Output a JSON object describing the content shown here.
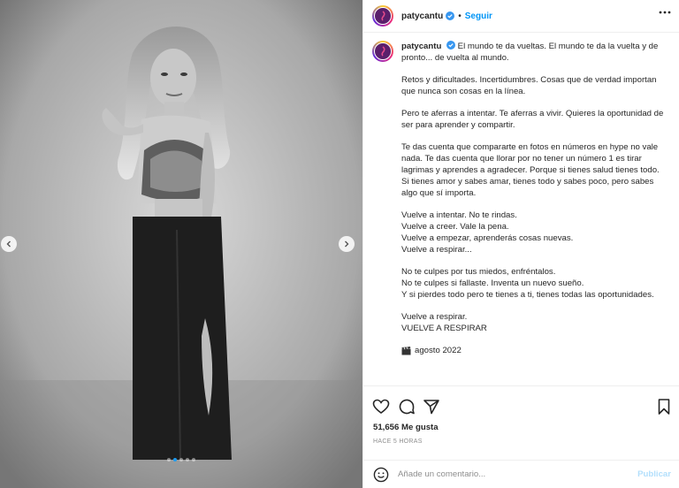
{
  "post": {
    "author": "patycantu",
    "follow_label": "Seguir",
    "separator": "•"
  },
  "caption": {
    "author": "patycantu",
    "head": "El mundo te da vueltas. El mundo te da la vuelta y de pronto... de vuelta al mundo.",
    "paragraphs": [
      "Retos y dificultades. Incertidumbres. Cosas que de verdad importan que nunca son cosas en la línea.",
      "Pero te aferras a intentar. Te aferras a vivir. Quieres la oportunidad de ser para aprender y compartir.",
      "Te das cuenta que compararte en fotos en números en hype no vale nada. Te das cuenta que llorar por no tener un número 1 es tirar lagrimas y aprendes a agradecer. Porque si tienes salud tienes todo. Si tienes amor y sabes amar, tienes todo y sabes poco, pero sabes algo que sí importa.",
      "Vuelve a intentar. No te rindas.\nVuelve a creer. Vale la pena.\nVuelve a empezar, aprenderás cosas nuevas.\nVuelve a respirar...",
      "No te culpes por tus miedos, enfréntalos.\nNo te culpes si fallaste. Inventa un nuevo sueño.\nY si pierdes todo pero te tienes a ti, tienes todas las oportunidades.",
      "Vuelve a respirar.\nVUELVE A RESPIRAR"
    ],
    "date_text": "agosto 2022"
  },
  "stats": {
    "likes": "51,656 Me gusta",
    "time_ago": "HACE 5 HORAS"
  },
  "comment_form": {
    "placeholder": "Añade un comentario...",
    "publish_label": "Publicar"
  },
  "carousel": {
    "total": 5,
    "active_index": 1
  },
  "icons": {
    "more": "more-dots-icon",
    "like": "heart-icon",
    "comment": "comment-bubble-icon",
    "share": "paper-plane-icon",
    "save": "bookmark-icon",
    "emoji": "smiley-icon",
    "verified": "verified-badge-icon",
    "prev": "chevron-left-icon",
    "next": "chevron-right-icon",
    "date": "clapperboard-icon"
  },
  "colors": {
    "accent": "#0095f6",
    "verified": "#3897f0",
    "muted": "#8e8e8e",
    "publish_disabled": "#b2dffc",
    "carousel_active": "#1d9bf0"
  }
}
